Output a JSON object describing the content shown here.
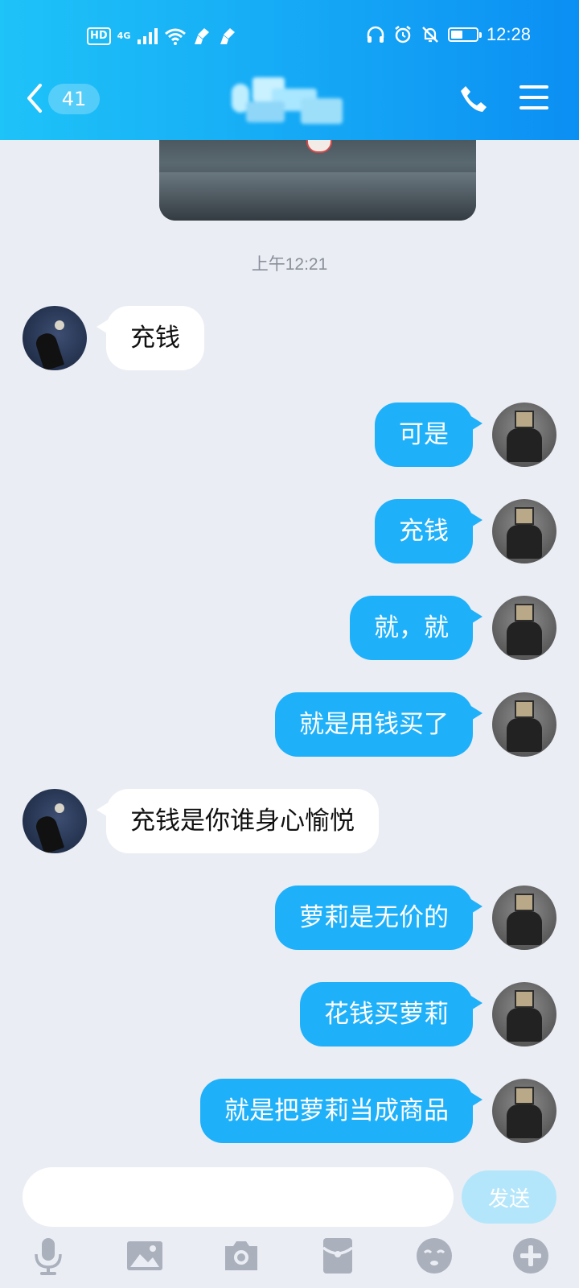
{
  "status_bar": {
    "left": {
      "hd": "HD",
      "network": "4G"
    },
    "time": "12:28",
    "battery_level": 0.45
  },
  "header": {
    "unread_count": "41",
    "icons": [
      "back-icon",
      "phone-icon",
      "menu-icon"
    ]
  },
  "chat": {
    "timestamp": "上午12:21",
    "messages": [
      {
        "side": "left",
        "text": "充钱"
      },
      {
        "side": "right",
        "text": "可是"
      },
      {
        "side": "right",
        "text": "充钱"
      },
      {
        "side": "right",
        "text": "就，就"
      },
      {
        "side": "right",
        "text": "就是用钱买了"
      },
      {
        "side": "left",
        "text": "充钱是你谁身心愉悦"
      },
      {
        "side": "right",
        "text": "萝莉是无价的"
      },
      {
        "side": "right",
        "text": "花钱买萝莉"
      },
      {
        "side": "right",
        "text": "就是把萝莉当成商品"
      }
    ]
  },
  "input": {
    "placeholder": "",
    "send_label": "发送"
  },
  "toolbar": {
    "icons": [
      "microphone-icon",
      "image-icon",
      "camera-icon",
      "red-packet-icon",
      "emoji-icon",
      "plus-icon"
    ]
  },
  "colors": {
    "header_start": "#1ec3f8",
    "header_end": "#0b8ff3",
    "bubble_self": "#1fb0fa",
    "bubble_other": "#ffffff",
    "background": "#eaedf4",
    "send_disabled": "#b4e6fb"
  }
}
